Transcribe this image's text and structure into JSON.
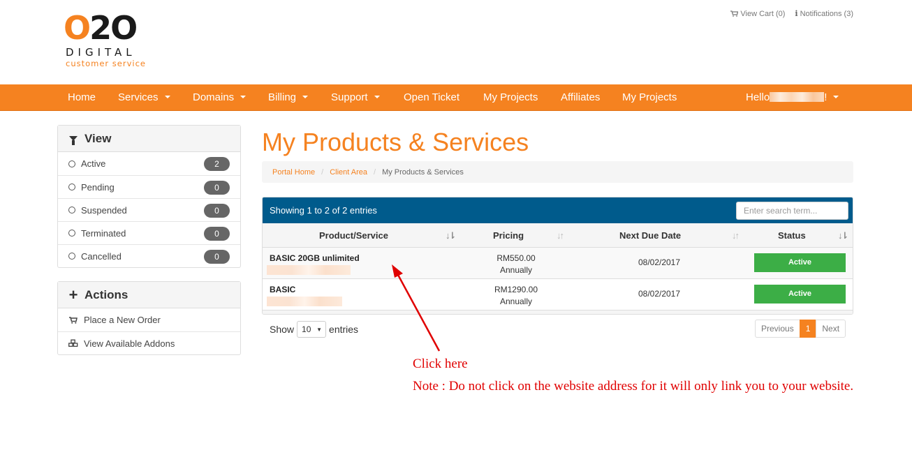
{
  "logo": {
    "part1": "O",
    "part2": "2",
    "part3": "O",
    "line2": "DIGITAL",
    "line3": "customer service"
  },
  "top_links": {
    "cart": "View Cart (0)",
    "notifications": "Notifications (3)"
  },
  "nav": {
    "items": [
      {
        "label": "Home"
      },
      {
        "label": "Services"
      },
      {
        "label": "Domains"
      },
      {
        "label": "Billing"
      },
      {
        "label": "Support"
      },
      {
        "label": "Open Ticket"
      },
      {
        "label": "My Projects"
      },
      {
        "label": "Affiliates"
      },
      {
        "label": "My Projects"
      }
    ],
    "user_prefix": "Hello",
    "user_suffix": "!"
  },
  "view_panel": {
    "title": "View",
    "items": [
      {
        "label": "Active",
        "count": "2"
      },
      {
        "label": "Pending",
        "count": "0"
      },
      {
        "label": "Suspended",
        "count": "0"
      },
      {
        "label": "Terminated",
        "count": "0"
      },
      {
        "label": "Cancelled",
        "count": "0"
      }
    ]
  },
  "actions_panel": {
    "title": "Actions",
    "items": [
      {
        "label": "Place a New Order"
      },
      {
        "label": "View Available Addons"
      }
    ]
  },
  "page_title": "My Products & Services",
  "breadcrumb": {
    "items": [
      "Portal Home",
      "Client Area"
    ],
    "current": "My Products & Services"
  },
  "table": {
    "info": "Showing 1 to 2 of 2 entries",
    "search_placeholder": "Enter search term...",
    "columns": [
      "Product/Service",
      "Pricing",
      "Next Due Date",
      "Status"
    ],
    "rows": [
      {
        "product": "BASIC 20GB unlimited",
        "price": "RM550.00",
        "cycle": "Annually",
        "due": "08/02/2017",
        "status": "Active"
      },
      {
        "product": "BASIC",
        "price": "RM1290.00",
        "cycle": "Annually",
        "due": "08/02/2017",
        "status": "Active"
      }
    ]
  },
  "length": {
    "show": "Show",
    "value": "10",
    "entries": "entries"
  },
  "pagination": {
    "previous": "Previous",
    "page": "1",
    "next": "Next"
  },
  "annotation": {
    "line1": "Click here",
    "line2": "Note : Do not click on the website address for it will only link you to your website."
  },
  "colors": {
    "brand_orange": "#f58220",
    "table_header_blue": "#005b8c",
    "status_green": "#3cae46",
    "annotation_red": "#e00000"
  }
}
